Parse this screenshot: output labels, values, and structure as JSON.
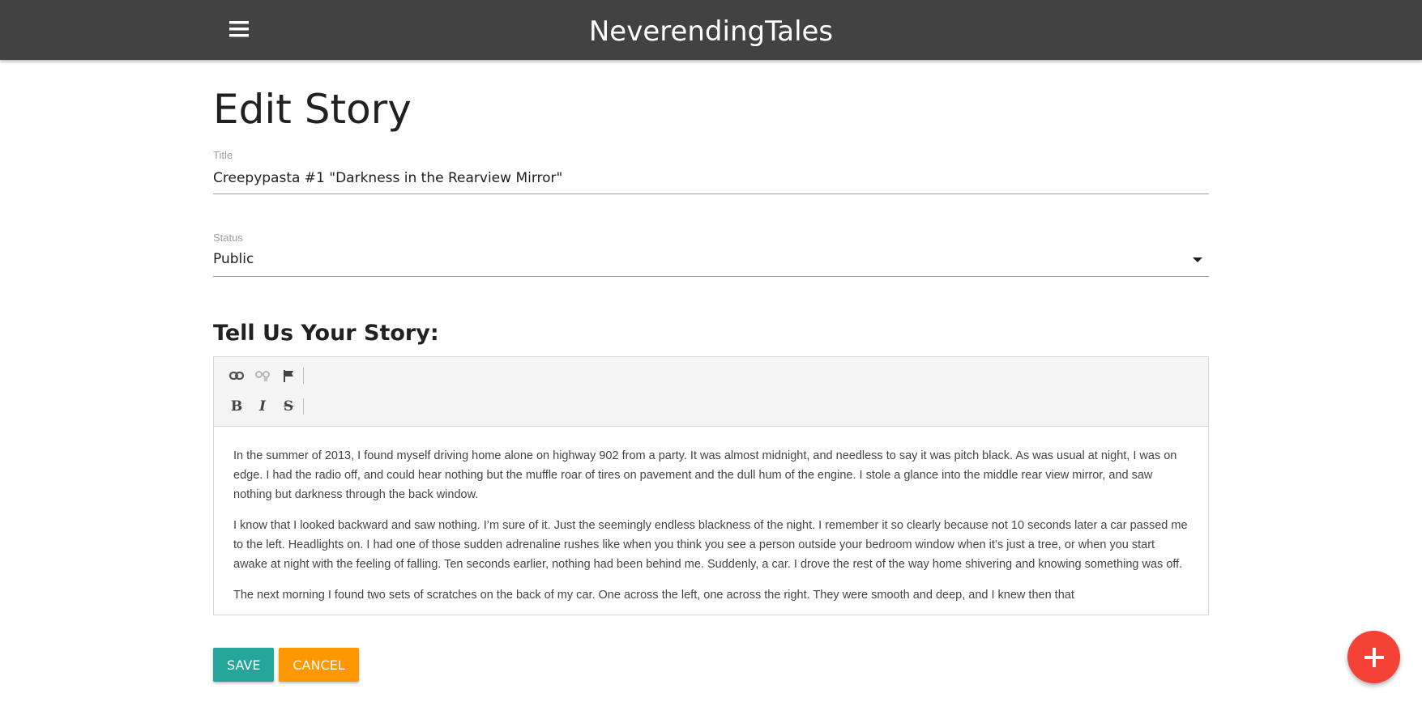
{
  "app": {
    "brand": "NeverendingTales"
  },
  "page": {
    "title": "Edit Story"
  },
  "form": {
    "title_label": "Title",
    "title_value": "Creepypasta #1 \"Darkness in the Rearview Mirror\"",
    "status_label": "Status",
    "status_value": "Public",
    "story_heading": "Tell Us Your Story:"
  },
  "editor": {
    "toolbar": {
      "row1": [
        "link-icon",
        "unlink-icon",
        "flag-icon"
      ],
      "row2": [
        "bold-icon",
        "italic-icon",
        "strikethrough-icon"
      ],
      "bold_glyph": "B",
      "italic_glyph": "I",
      "strike_glyph": "S"
    },
    "paragraphs": [
      "In the summer of 2013, I found myself driving home alone on highway 902 from a party. It was almost midnight, and needless to say it was pitch black. As was usual at night, I was on edge. I had the radio off, and could hear nothing but the muffle roar of tires on pavement and the dull hum of the engine. I stole a glance into the middle rear view mirror, and saw nothing but darkness through the back window.",
      "I know that I looked backward and saw nothing. I’m sure of it. Just the seemingly endless blackness of the night. I remember it so clearly because not 10 seconds later a car passed me to the left. Headlights on. I had one of those sudden adrenaline rushes like when you think you see a person outside your bedroom window when it’s just a tree, or when you start awake at night with the feeling of falling. Ten seconds earlier, nothing had been behind me. Suddenly, a car. I drove the rest of the way home shivering and knowing something was off.",
      "The next morning I found two sets of scratches on the back of my car. One across the left, one across the right. They were smooth and deep, and I knew then that"
    ]
  },
  "actions": {
    "save_label": "Save",
    "cancel_label": "Cancel"
  },
  "colors": {
    "navbar": "#424242",
    "save": "#26a69a",
    "cancel": "#ff9800",
    "fab": "#f44336"
  },
  "icons": {
    "menu": "hamburger-menu-icon",
    "fab": "plus-icon"
  }
}
